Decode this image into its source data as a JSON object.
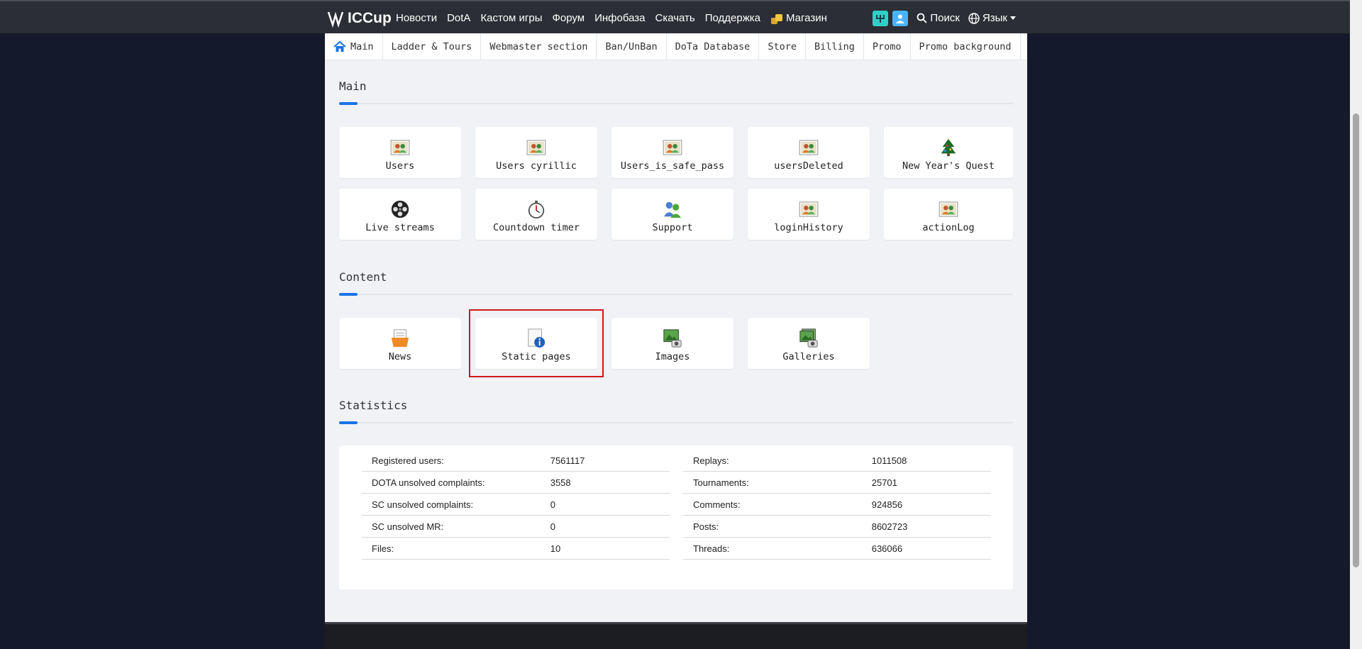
{
  "brand": {
    "name": "ICCup"
  },
  "topnav": {
    "items": [
      "Новости",
      "DotA",
      "Кастом игры",
      "Форум",
      "Инфобаза",
      "Скачать",
      "Поддержка"
    ],
    "shop": "Магазин",
    "search": "Поиск",
    "lang": "Язык"
  },
  "subnav": [
    "Main",
    "Ladder & Tours",
    "Webmaster section",
    "Ban/UnBan",
    "DoTa Database",
    "Store",
    "Billing",
    "Promo",
    "Promo background"
  ],
  "sections": {
    "main": "Main",
    "content": "Content",
    "statistics": "Statistics"
  },
  "main_cards": [
    {
      "label": "Users",
      "icon": "users-icon"
    },
    {
      "label": "Users cyrillic",
      "icon": "users-icon"
    },
    {
      "label": "Users_is_safe_pass",
      "icon": "users-icon"
    },
    {
      "label": "usersDeleted",
      "icon": "users-icon"
    },
    {
      "label": "New Year's Quest",
      "icon": "christmas-tree-icon"
    },
    {
      "label": "Live streams",
      "icon": "film-reel-icon"
    },
    {
      "label": "Countdown timer",
      "icon": "stopwatch-icon"
    },
    {
      "label": "Support",
      "icon": "support-people-icon"
    },
    {
      "label": "loginHistory",
      "icon": "users-icon"
    },
    {
      "label": "actionLog",
      "icon": "users-icon"
    }
  ],
  "content_cards": [
    {
      "label": "News",
      "icon": "news-folder-icon"
    },
    {
      "label": "Static pages",
      "icon": "info-page-icon"
    },
    {
      "label": "Images",
      "icon": "image-icon"
    },
    {
      "label": "Galleries",
      "icon": "gallery-icon"
    }
  ],
  "stats_left": [
    {
      "label": "Registered users:",
      "value": "7561117"
    },
    {
      "label": "DOTA unsolved complaints:",
      "value": "3558"
    },
    {
      "label": "SC unsolved complaints:",
      "value": "0"
    },
    {
      "label": "SC unsolved MR:",
      "value": "0"
    },
    {
      "label": "Files:",
      "value": "10"
    }
  ],
  "stats_right": [
    {
      "label": "Replays:",
      "value": "1011508"
    },
    {
      "label": "Tournaments:",
      "value": "25701"
    },
    {
      "label": "Comments:",
      "value": "924856"
    },
    {
      "label": "Posts:",
      "value": "8602723"
    },
    {
      "label": "Threads:",
      "value": "636066"
    }
  ],
  "colors": {
    "accent": "#1a73e8",
    "highlight": "#d0161b",
    "topbar": "#2b2e34"
  }
}
